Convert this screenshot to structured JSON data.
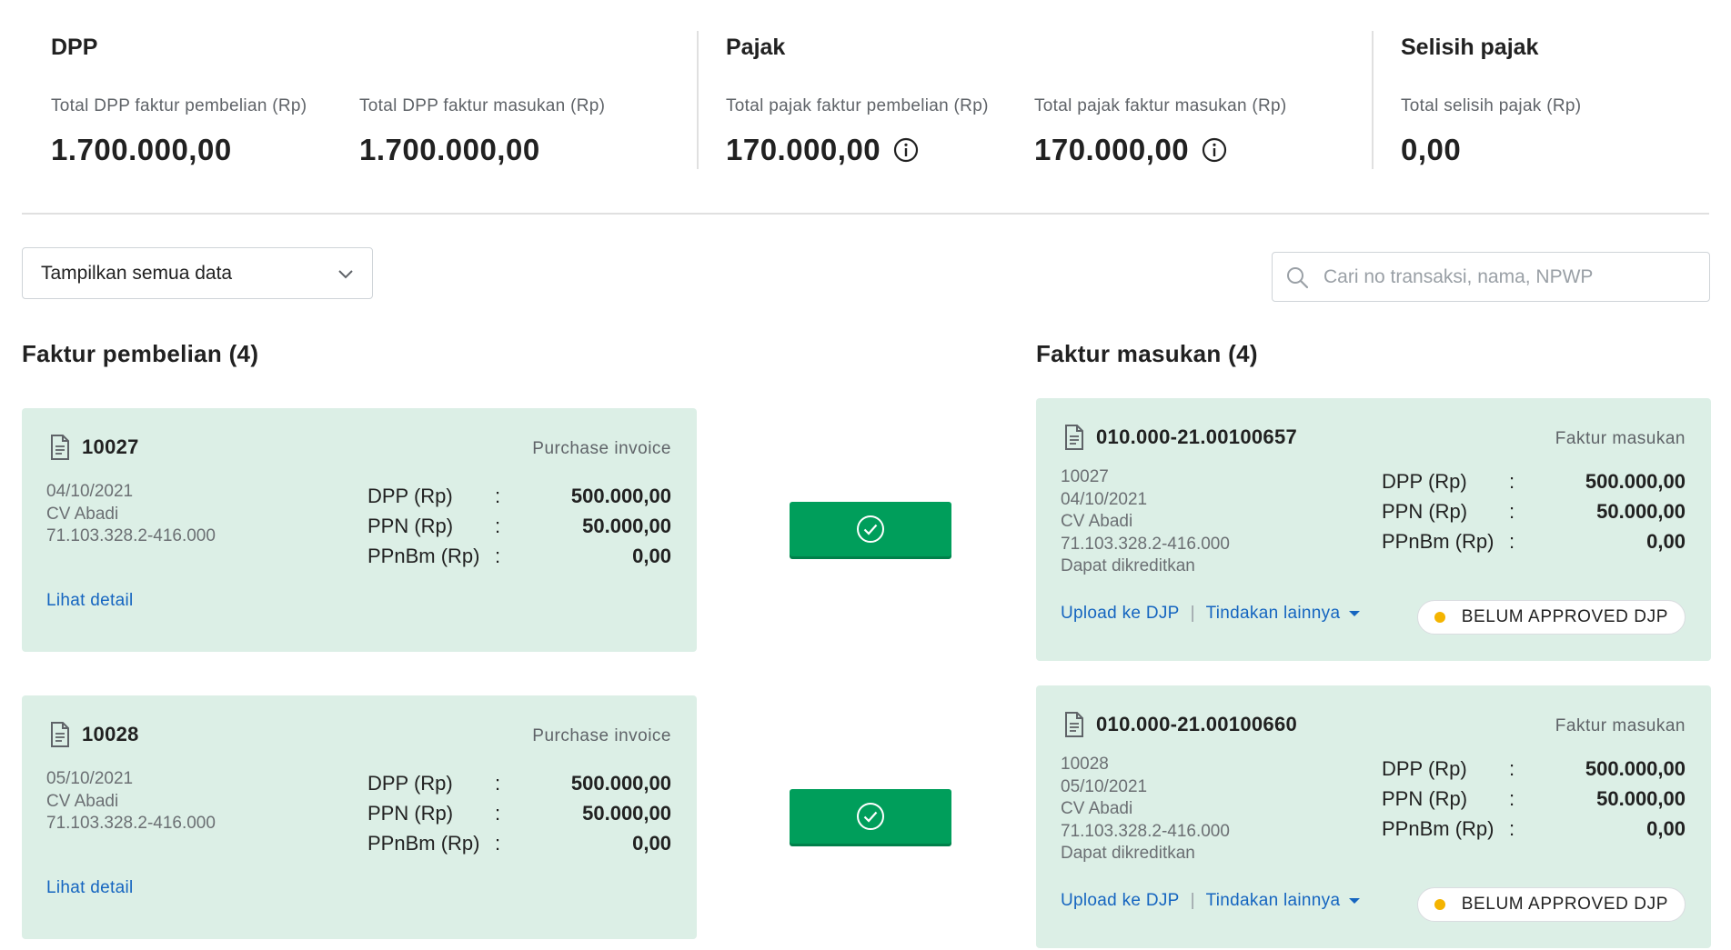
{
  "summary": {
    "dpp": {
      "title": "DPP",
      "items": [
        {
          "label": "Total DPP faktur pembelian (Rp)",
          "value": "1.700.000,00"
        },
        {
          "label": "Total DPP faktur masukan (Rp)",
          "value": "1.700.000,00"
        }
      ]
    },
    "pajak": {
      "title": "Pajak",
      "items": [
        {
          "label": "Total pajak faktur pembelian (Rp)",
          "value": "170.000,00"
        },
        {
          "label": "Total pajak faktur masukan (Rp)",
          "value": "170.000,00"
        }
      ]
    },
    "selisih": {
      "title": "Selisih pajak",
      "items": [
        {
          "label": "Total selisih pajak (Rp)",
          "value": "0,00"
        }
      ]
    }
  },
  "filter": {
    "selected": "Tampilkan semua data"
  },
  "search": {
    "placeholder": "Cari no transaksi, nama, NPWP"
  },
  "left_section": {
    "title": "Faktur pembelian (4)",
    "cards": [
      {
        "number": "10027",
        "type": "Purchase invoice",
        "date": "04/10/2021",
        "vendor": "CV Abadi",
        "npwp": "71.103.328.2-416.000",
        "dpp_label": "DPP (Rp)",
        "dpp": "500.000,00",
        "ppn_label": "PPN (Rp)",
        "ppn": "50.000,00",
        "ppnbm_label": "PPnBm (Rp)",
        "ppnbm": "0,00",
        "colon": ":",
        "link": "Lihat detail"
      },
      {
        "number": "10028",
        "type": "Purchase invoice",
        "date": "05/10/2021",
        "vendor": "CV Abadi",
        "npwp": "71.103.328.2-416.000",
        "dpp_label": "DPP (Rp)",
        "dpp": "500.000,00",
        "ppn_label": "PPN (Rp)",
        "ppn": "50.000,00",
        "ppnbm_label": "PPnBm (Rp)",
        "ppnbm": "0,00",
        "colon": ":",
        "link": "Lihat detail"
      }
    ]
  },
  "right_section": {
    "title": "Faktur masukan (4)",
    "cards": [
      {
        "number": "010.000-21.00100657",
        "type": "Faktur masukan",
        "ref": "10027",
        "date": "04/10/2021",
        "vendor": "CV Abadi",
        "npwp": "71.103.328.2-416.000",
        "credit": "Dapat dikreditkan",
        "dpp_label": "DPP (Rp)",
        "dpp": "500.000,00",
        "ppn_label": "PPN (Rp)",
        "ppn": "50.000,00",
        "ppnbm_label": "PPnBm (Rp)",
        "ppnbm": "0,00",
        "colon": ":",
        "upload": "Upload ke DJP",
        "separator": "|",
        "more": "Tindakan lainnya",
        "status": "BELUM APPROVED DJP"
      },
      {
        "number": "010.000-21.00100660",
        "type": "Faktur masukan",
        "ref": "10028",
        "date": "05/10/2021",
        "vendor": "CV Abadi",
        "npwp": "71.103.328.2-416.000",
        "credit": "Dapat dikreditkan",
        "dpp_label": "DPP (Rp)",
        "dpp": "500.000,00",
        "ppn_label": "PPN (Rp)",
        "ppn": "50.000,00",
        "ppnbm_label": "PPnBm (Rp)",
        "ppnbm": "0,00",
        "colon": ":",
        "upload": "Upload ke DJP",
        "separator": "|",
        "more": "Tindakan lainnya",
        "status": "BELUM APPROVED DJP"
      }
    ]
  },
  "icons": {
    "info": "info-icon",
    "document": "document-icon",
    "search": "search-icon",
    "chevron": "chevron-down-icon",
    "check": "check-circle-icon"
  },
  "colors": {
    "card_bg": "#dcefe6",
    "match_button": "#009e5b",
    "link": "#1565c0",
    "status_dot": "#f4b400"
  }
}
